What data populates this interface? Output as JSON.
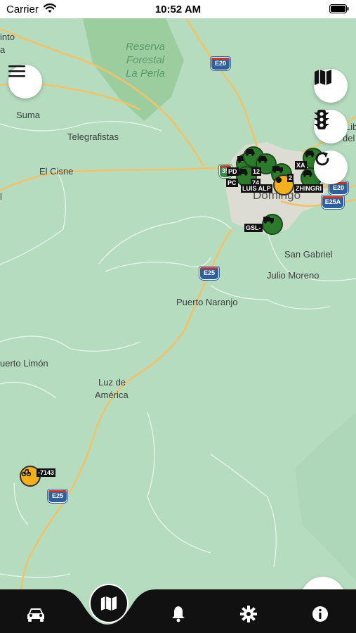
{
  "status_bar": {
    "carrier": "Carrier",
    "time": "10:52 AM"
  },
  "map": {
    "forest_label": "Reserva Forestal La Perla",
    "forest_lines": [
      "Reserva",
      "Forestal",
      "La Perla"
    ],
    "city_label": "Domingo",
    "places": [
      "into",
      "a",
      "Suma",
      "Telegrafistas",
      "El Cisne",
      "l",
      "San Gabriel",
      "Julio Moreno",
      "Puerto Naranjo",
      "uerto Limón",
      "Luz de",
      "América",
      "Lib",
      "del"
    ],
    "shields": [
      "E20",
      "E25",
      "E25",
      "E25A",
      "E20",
      "35"
    ]
  },
  "vehicles": {
    "plates": [
      "PD",
      "12",
      "PC",
      "74",
      "XA",
      "LUIS ALP",
      "ZHINGRI",
      "GSL-",
      "-7143",
      "2"
    ]
  },
  "buttons": {
    "menu": "menu",
    "map_layers": "map-layers",
    "traffic": "traffic",
    "refresh": "refresh"
  },
  "tabbar": {
    "tabs": [
      "vehicles",
      "map",
      "alerts",
      "settings",
      "info"
    ],
    "active": "map"
  }
}
